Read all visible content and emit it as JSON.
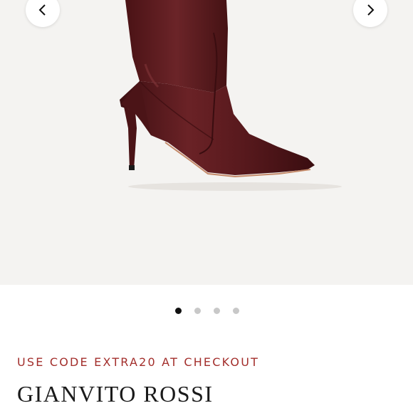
{
  "gallery": {
    "prev_icon": "chevron-left-icon",
    "next_icon": "chevron-right-icon",
    "slide_count": 4,
    "active_slide": 1,
    "background": "#f4f3f1",
    "product_color": "#5e1d1f"
  },
  "promo": {
    "text": "USE CODE EXTRA20 AT CHECKOUT",
    "color": "#a32f2c"
  },
  "product": {
    "brand": "GIANVITO ROSSI"
  }
}
